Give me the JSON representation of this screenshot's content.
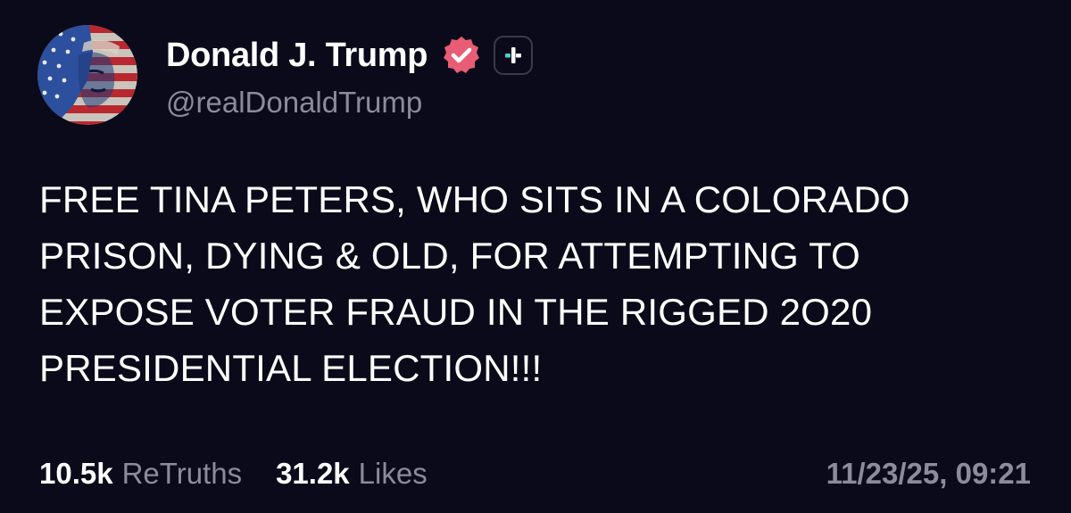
{
  "author": {
    "display_name": "Donald J. Trump",
    "handle": "@realDonaldTrump",
    "avatar_icon": "flag-portrait-avatar",
    "verified_icon": "verified-badge-icon",
    "follow_icon": "plus-icon"
  },
  "post": {
    "lines": [
      "FREE TINA PETERS, WHO SITS IN A COLORADO",
      "PRISON, DYING & OLD, FOR ATTEMPTING TO",
      "EXPOSE VOTER FRAUD IN THE RIGGED 2O20",
      "PRESIDENTIAL ELECTION!!!"
    ]
  },
  "stats": {
    "retruths_count": "10.5k",
    "retruths_label": "ReTruths",
    "likes_count": "31.2k",
    "likes_label": "Likes"
  },
  "timestamp": "11/23/25, 09:21",
  "colors": {
    "background": "#0a0a1a",
    "text": "#ffffff",
    "muted": "#8b8b9c",
    "verified": "#e85d75",
    "follow_accent": "#4fd1c5"
  }
}
